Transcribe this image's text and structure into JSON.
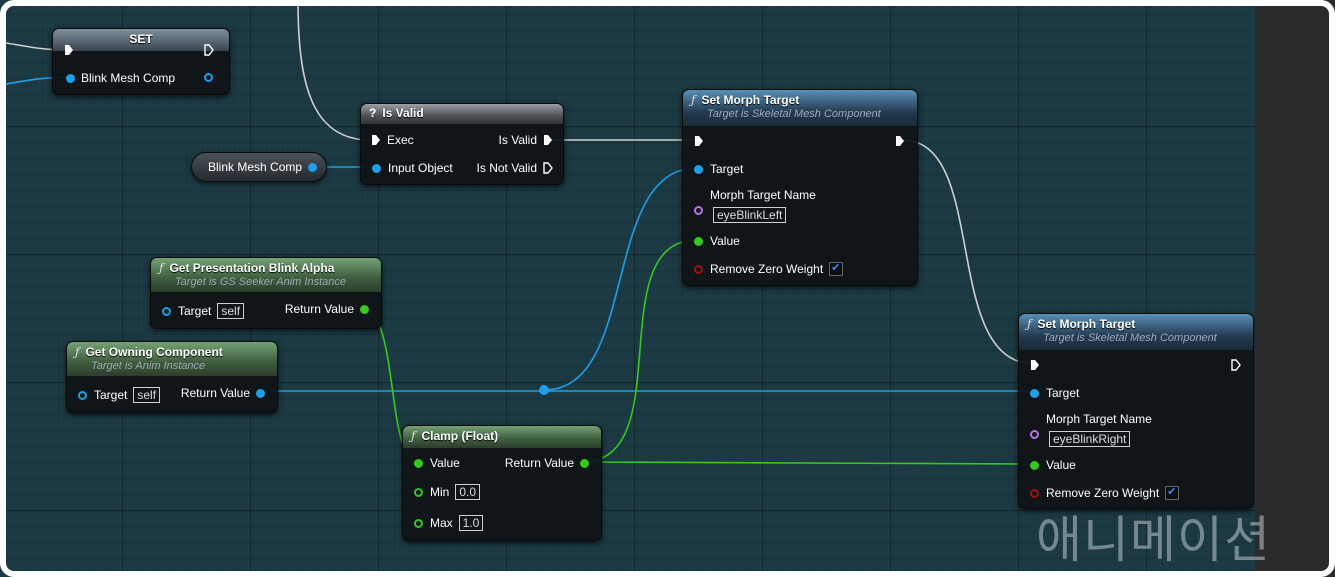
{
  "set_node": {
    "title": "SET",
    "pin_label": "Blink Mesh Comp"
  },
  "is_valid_node": {
    "title": "Is Valid",
    "exec_label": "Exec",
    "is_valid_label": "Is Valid",
    "input_object_label": "Input Object",
    "is_not_valid_label": "Is Not Valid"
  },
  "blink_var": {
    "label": "Blink Mesh Comp"
  },
  "morph_left": {
    "title": "Set Morph Target",
    "subtitle": "Target is Skeletal Mesh Component",
    "target_label": "Target",
    "morph_name_label": "Morph Target Name",
    "morph_name_value": "eyeBlinkLeft",
    "value_label": "Value",
    "remove_zero_label": "Remove Zero Weight",
    "remove_zero_checked": true
  },
  "morph_right": {
    "title": "Set Morph Target",
    "subtitle": "Target is Skeletal Mesh Component",
    "target_label": "Target",
    "morph_name_label": "Morph Target Name",
    "morph_name_value": "eyeBlinkRight",
    "value_label": "Value",
    "remove_zero_label": "Remove Zero Weight",
    "remove_zero_checked": true
  },
  "get_blink": {
    "title": "Get Presentation Blink Alpha",
    "subtitle": "Target is GS Seeker Anim Instance",
    "target_label": "Target",
    "target_value": "self",
    "return_label": "Return Value"
  },
  "get_owning": {
    "title": "Get Owning Component",
    "subtitle": "Target is Anim Instance",
    "target_label": "Target",
    "target_value": "self",
    "return_label": "Return Value"
  },
  "clamp": {
    "title": "Clamp (Float)",
    "value_label": "Value",
    "return_label": "Return Value",
    "min_label": "Min",
    "min_value": "0.0",
    "max_label": "Max",
    "max_value": "1.0"
  },
  "watermark": "애니메이션",
  "colors": {
    "exec": "#ffffff",
    "object": "#1ea0e8",
    "float": "#36c81e",
    "name": "#b675e0",
    "bool": "#a01010",
    "header_function": "#3a6a90",
    "header_pure": "#4e7a50"
  },
  "icons": {
    "function": "function-f-icon",
    "macro": "question-mark-icon",
    "exec": "exec-arrow-icon",
    "checkbox": "checkmark-icon"
  }
}
